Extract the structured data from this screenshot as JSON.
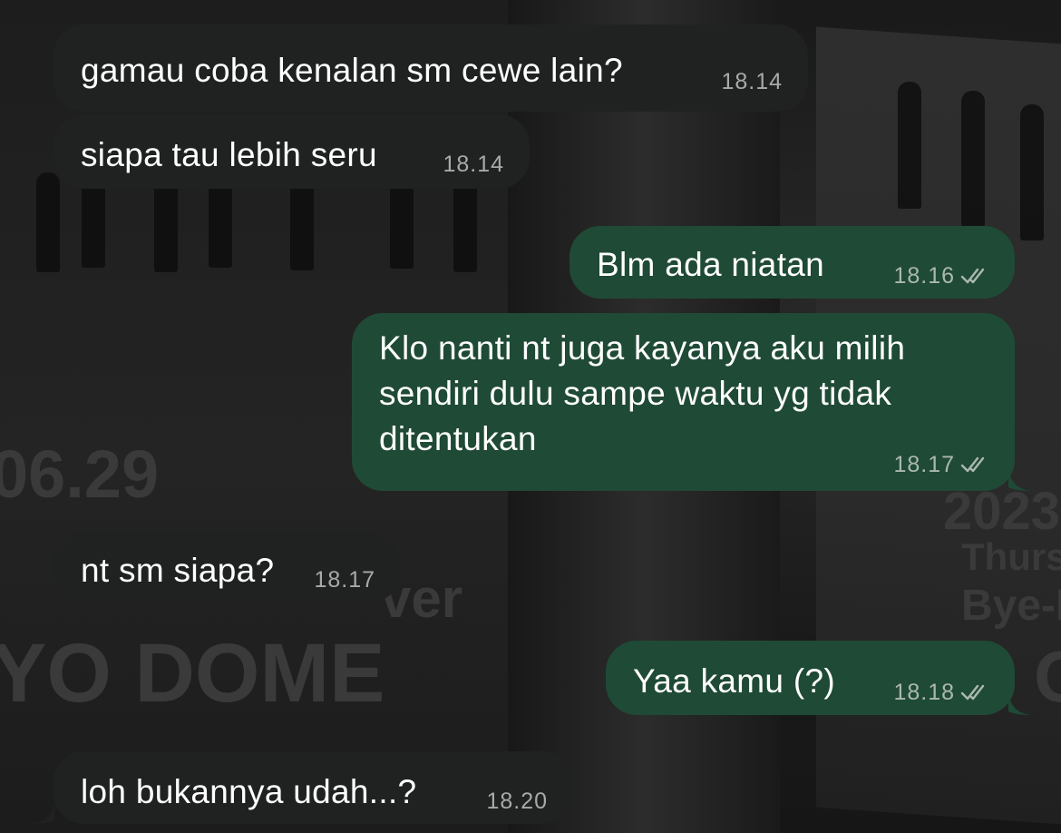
{
  "wallpaper": {
    "texts": [
      "06.29",
      "ver",
      "YO DOME",
      "2023",
      "Thursd",
      "Bye-E",
      "O"
    ]
  },
  "messages": [
    {
      "direction": "incoming",
      "text": "gamau coba kenalan sm cewe lain?",
      "time": "18.14"
    },
    {
      "direction": "incoming",
      "text": "siapa tau lebih seru",
      "time": "18.14"
    },
    {
      "direction": "outgoing",
      "text": "Blm ada niatan",
      "time": "18.16",
      "status": "read"
    },
    {
      "direction": "outgoing",
      "text": "Klo nanti nt juga kayanya aku milih sendiri dulu sampe waktu yg tidak ditentukan",
      "time": "18.17",
      "status": "read"
    },
    {
      "direction": "incoming",
      "text": "nt sm siapa?",
      "time": "18.17"
    },
    {
      "direction": "outgoing",
      "text": "Yaa kamu (?)",
      "time": "18.18",
      "status": "read"
    },
    {
      "direction": "incoming",
      "text": "loh bukannya udah...?",
      "time": "18.20"
    }
  ],
  "colors": {
    "incoming_bubble": "#1f2220",
    "outgoing_bubble": "#1f4a36",
    "text": "#ffffff",
    "timestamp": "#a7aba8"
  },
  "icons": {
    "read_receipt": "double-check-icon"
  }
}
